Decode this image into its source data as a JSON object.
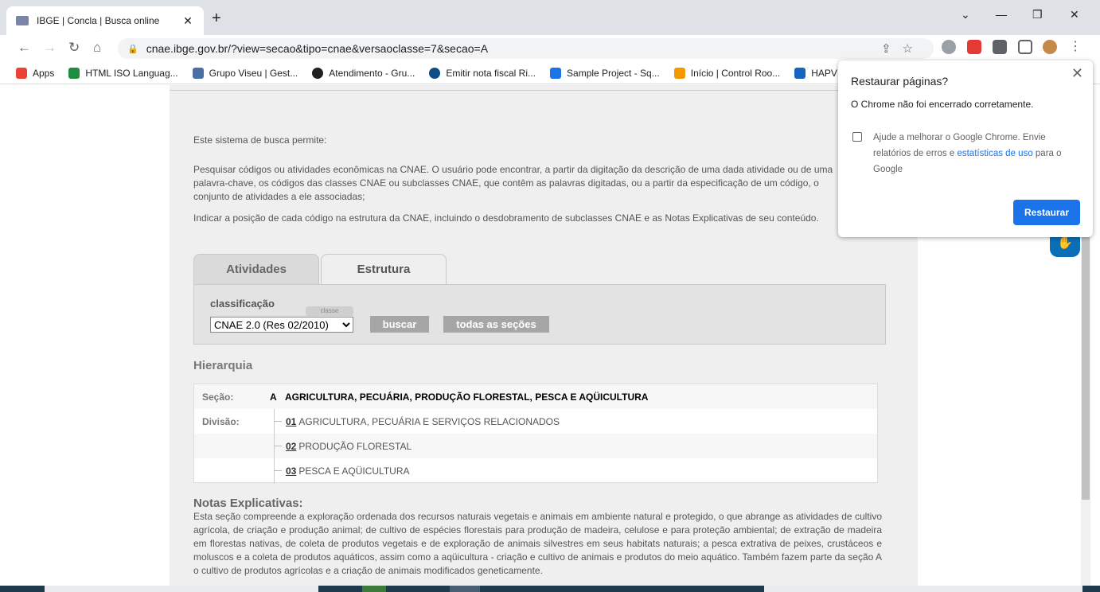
{
  "browser": {
    "tab_title": "IBGE | Concla | Busca online",
    "tab_close": "✕",
    "new_tab": "+",
    "url": "cnae.ibge.gov.br/?view=secao&tipo=cnae&versaoclasse=7&secao=A",
    "window_controls": [
      "⌄",
      "—",
      "❐",
      "✕"
    ]
  },
  "bookmarks": [
    {
      "label": "Apps",
      "color": "#ea4335"
    },
    {
      "label": "HTML ISO Languag...",
      "color": "#1e8e3e"
    },
    {
      "label": "Grupo Viseu | Gest...",
      "color": "#4a6fa5"
    },
    {
      "label": "Atendimento - Gru...",
      "color": "#202124"
    },
    {
      "label": "Emitir nota fiscal Ri...",
      "color": "#0d4c84"
    },
    {
      "label": "Sample Project - Sq...",
      "color": "#1a73e8"
    },
    {
      "label": "Início | Control Roo...",
      "color": "#f29900"
    },
    {
      "label": "HAPVIDA",
      "color": "#1565c0"
    }
  ],
  "page": {
    "intro": "Este sistema de busca permite:",
    "para1": "Pesquisar códigos ou atividades econômicas na CNAE. O usuário pode encontrar, a partir da digitação da descrição de uma dada atividade ou de uma palavra-chave, os códigos das classes CNAE ou subclasses CNAE, que contêm as palavras digitadas, ou a partir da especificação de um código, o conjunto de atividades a ele associadas;",
    "para2": "Indicar a posição de cada código na estrutura da CNAE, incluindo o desdobramento de subclasses CNAE e as Notas Explicativas de seu conteúdo.",
    "tabs": [
      "Atividades",
      "Estrutura"
    ],
    "classificacao_label": "classificação",
    "classe_hint": "classe",
    "select_value": "CNAE 2.0 (Res 02/2010)",
    "buscar": "buscar",
    "todas": "todas as seções",
    "hierarquia": "Hierarquia",
    "secao_key": "Seção:",
    "secao_code": "A",
    "secao_name": "AGRICULTURA, PECUÁRIA, PRODUÇÃO FLORESTAL, PESCA E AQÜICULTURA",
    "divisao_key": "Divisão:",
    "divisoes": [
      {
        "code": "01",
        "name": "AGRICULTURA, PECUÁRIA E SERVIÇOS RELACIONADOS"
      },
      {
        "code": "02",
        "name": "PRODUÇÃO FLORESTAL"
      },
      {
        "code": "03",
        "name": "PESCA E AQÜICULTURA"
      }
    ],
    "notas_title": "Notas Explicativas:",
    "notas_text": "Esta seção compreende a exploração ordenada dos recursos naturais vegetais e animais em ambiente natural e protegido, o que abrange as atividades de cultivo agrícola, de criação e produção animal; de cultivo de espécies florestais para produção de madeira, celulose e para proteção ambiental; de extração de madeira em florestas nativas, de coleta de produtos vegetais e de exploração de animais silvestres em seus habitats naturais; a pesca extrativa de peixes, crustáceos e moluscos e a coleta de produtos aquáticos, assim como a aqüicultura - criação e cultivo de animais e produtos do meio aquático. Também fazem parte da seção A o cultivo de produtos agrícolas e a criação de animais modificados geneticamente."
  },
  "popup": {
    "title": "Restaurar páginas?",
    "close": "✕",
    "message": "O Chrome não foi encerrado corretamente.",
    "check_text_1": "Ajude a melhorar o Google Chrome. Envie relatórios de erros e ",
    "check_link": "estatísticas de uso",
    "check_text_2": " para o Google",
    "button": "Restaurar"
  }
}
